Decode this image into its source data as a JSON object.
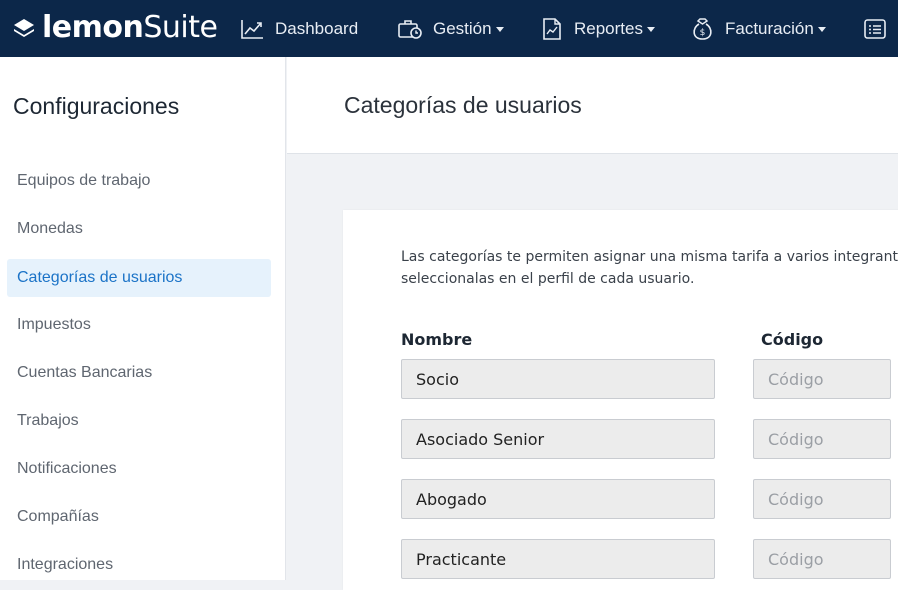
{
  "app": {
    "logo_bold": "lemon",
    "logo_light": "Suite"
  },
  "nav": [
    {
      "label": "Dashboard",
      "icon": "chart-line-icon",
      "dropdown": false
    },
    {
      "label": "Gestión",
      "icon": "briefcase-clock-icon",
      "dropdown": true
    },
    {
      "label": "Reportes",
      "icon": "document-chart-icon",
      "dropdown": true
    },
    {
      "label": "Facturación",
      "icon": "money-bag-icon",
      "dropdown": true
    }
  ],
  "sidebar": {
    "title": "Configuraciones",
    "items": [
      {
        "label": "Equipos de trabajo"
      },
      {
        "label": "Monedas"
      },
      {
        "label": "Categorías de usuarios",
        "active": true
      },
      {
        "label": "Impuestos"
      },
      {
        "label": "Cuentas Bancarias"
      },
      {
        "label": "Trabajos"
      },
      {
        "label": "Notificaciones"
      },
      {
        "label": "Compañías"
      },
      {
        "label": "Integraciones"
      }
    ]
  },
  "page": {
    "title": "Categorías de usuarios",
    "description_line1": "Las categorías te permiten asignar una misma tarifa a varios integrant",
    "description_line2": "seleccionalas en el perfil de cada usuario."
  },
  "table": {
    "col_name": "Nombre",
    "col_code": "Código",
    "code_placeholder": "Código",
    "rows": [
      {
        "name": "Socio",
        "code": ""
      },
      {
        "name": "Asociado Senior",
        "code": ""
      },
      {
        "name": "Abogado",
        "code": ""
      },
      {
        "name": "Practicante",
        "code": ""
      }
    ]
  },
  "colors": {
    "topbar": "#0c2749",
    "active_bg": "#e6f2fc",
    "active_text": "#1b73c7"
  }
}
